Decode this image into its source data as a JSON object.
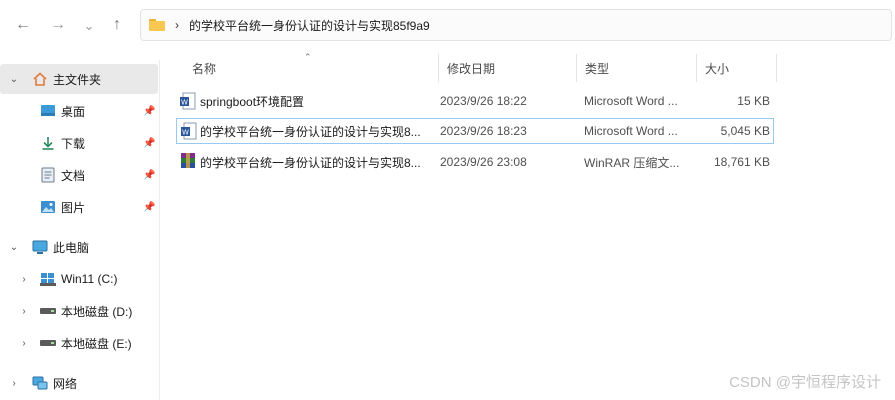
{
  "toolbar": {
    "back_icon": "←",
    "forward_icon": "→",
    "recent_icon": "⌄",
    "up_icon": "↑"
  },
  "address_bar": {
    "separator": "›",
    "path": "的学校平台统一身份认证的设计与实现85f9a9"
  },
  "sidebar": {
    "quick_access": "主文件夹",
    "items": [
      {
        "label": "桌面",
        "icon": "desktop-icon",
        "pinned": true
      },
      {
        "label": "下载",
        "icon": "download-icon",
        "pinned": true
      },
      {
        "label": "文档",
        "icon": "document-icon",
        "pinned": true
      },
      {
        "label": "图片",
        "icon": "pictures-icon",
        "pinned": true
      }
    ],
    "this_pc": "此电脑",
    "drives": [
      {
        "label": "Win11 (C:)",
        "icon": "windows-drive-icon"
      },
      {
        "label": "本地磁盘 (D:)",
        "icon": "drive-icon"
      },
      {
        "label": "本地磁盘 (E:)",
        "icon": "drive-icon"
      }
    ],
    "network": "网络"
  },
  "columns": {
    "name": "名称",
    "modified": "修改日期",
    "type": "类型",
    "size": "大小"
  },
  "files": [
    {
      "name": "springboot环境配置",
      "modified": "2023/9/26 18:22",
      "type": "Microsoft Word ...",
      "size": "15 KB",
      "icon": "word-doc-icon"
    },
    {
      "name": "的学校平台统一身份认证的设计与实现8...",
      "modified": "2023/9/26 18:23",
      "type": "Microsoft Word ...",
      "size": "5,045 KB",
      "icon": "word-doc-icon"
    },
    {
      "name": "的学校平台统一身份认证的设计与实现8...",
      "modified": "2023/9/26 23:08",
      "type": "WinRAR 压缩文...",
      "size": "18,761 KB",
      "icon": "winrar-archive-icon"
    }
  ],
  "watermark": "CSDN @宇恒程序设计",
  "colors": {
    "selected_nav": "#e9e9e9",
    "focus_border": "#99c9ef",
    "folder_yellow": "#f7c74f",
    "word_blue": "#2b579a"
  }
}
